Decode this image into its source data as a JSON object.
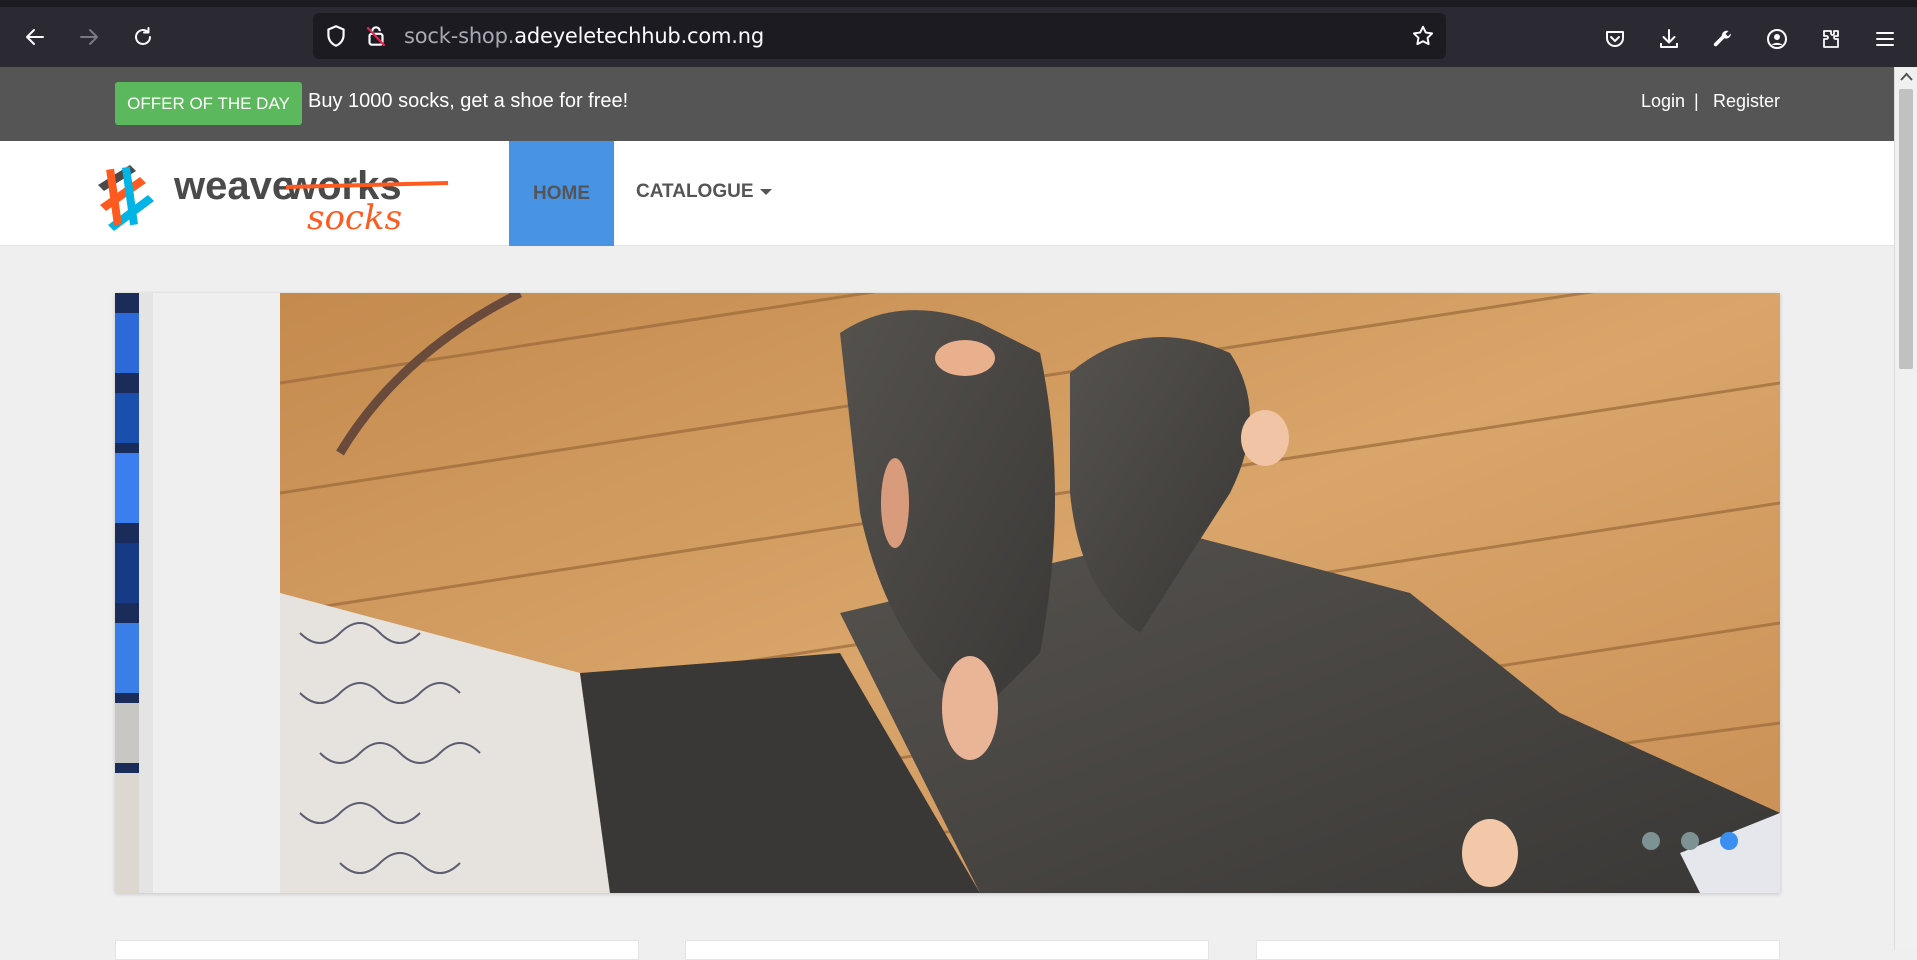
{
  "browser": {
    "url_prefix": "sock-shop.",
    "url_domain": "adeyeletechhub.com.ng"
  },
  "offer": {
    "badge": "OFFER OF THE DAY",
    "text": "Buy 1000 socks, get a shoe for free!"
  },
  "account": {
    "login": "Login",
    "separator": "|",
    "register": "Register"
  },
  "navbar": {
    "home": "HOME",
    "catalogue": "CATALOGUE"
  },
  "logo": {
    "word1": "weave",
    "word2": "works",
    "word3": "socks"
  },
  "carousel": {
    "slides": 3,
    "active_slide": 3
  },
  "colors": {
    "offer_bg": "#555555",
    "badge": "#5cb85c",
    "nav_active": "#4993e4",
    "logo_orange": "#ff5a1f",
    "logo_blue": "#00b4e6",
    "logo_gray": "#4a4a4a"
  }
}
